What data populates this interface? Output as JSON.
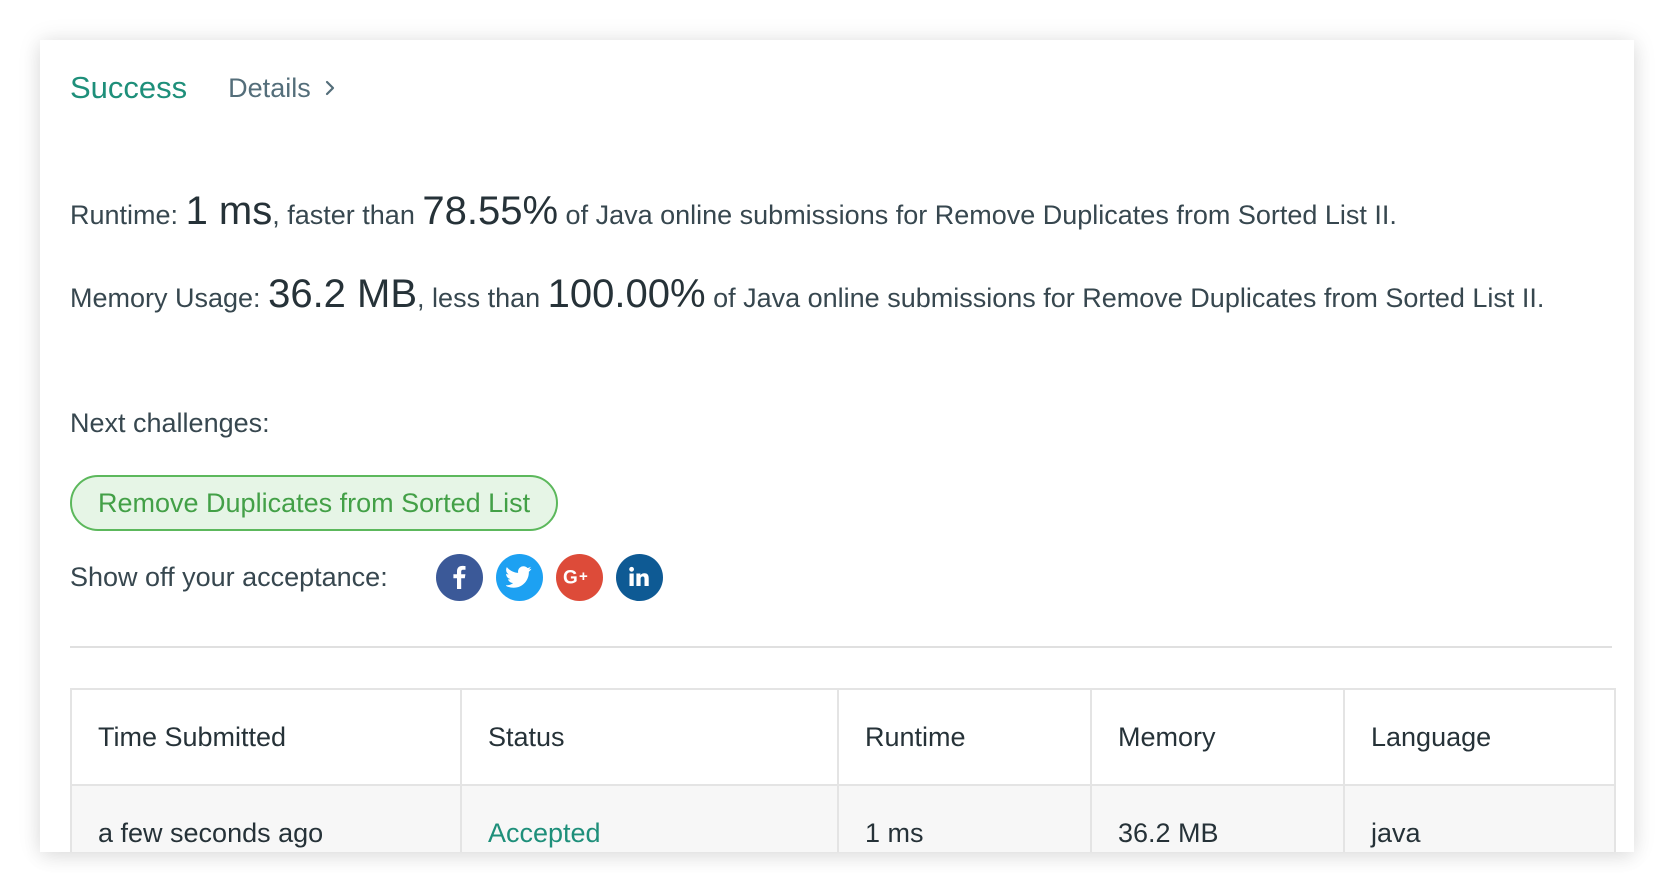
{
  "result": {
    "status": "Success",
    "details_label": "Details",
    "status_color": "#1e8f7a"
  },
  "runtime": {
    "label": "Runtime:",
    "value": "1 ms",
    "comparison": ", faster than",
    "percent": "78.55%",
    "suffix": "of Java online submissions for Remove Duplicates from Sorted List II."
  },
  "memory": {
    "label": "Memory Usage:",
    "value": "36.2 MB",
    "comparison": ", less than",
    "percent": "100.00%",
    "suffix": "of Java online submissions for Remove Duplicates from Sorted List II."
  },
  "next": {
    "label": "Next challenges:",
    "challenge": "Remove Duplicates from Sorted List"
  },
  "share": {
    "label": "Show off your acceptance:",
    "icons": [
      {
        "name": "facebook-icon",
        "color": "#3b5998"
      },
      {
        "name": "twitter-icon",
        "color": "#1da1f2"
      },
      {
        "name": "google-plus-icon",
        "color": "#dd4b39"
      },
      {
        "name": "linkedin-icon",
        "color": "#0e5a94"
      }
    ]
  },
  "table": {
    "headers": [
      "Time Submitted",
      "Status",
      "Runtime",
      "Memory",
      "Language"
    ],
    "rows": [
      {
        "time": "a few seconds ago",
        "status": "Accepted",
        "runtime": "1 ms",
        "memory": "36.2 MB",
        "language": "java"
      }
    ]
  }
}
